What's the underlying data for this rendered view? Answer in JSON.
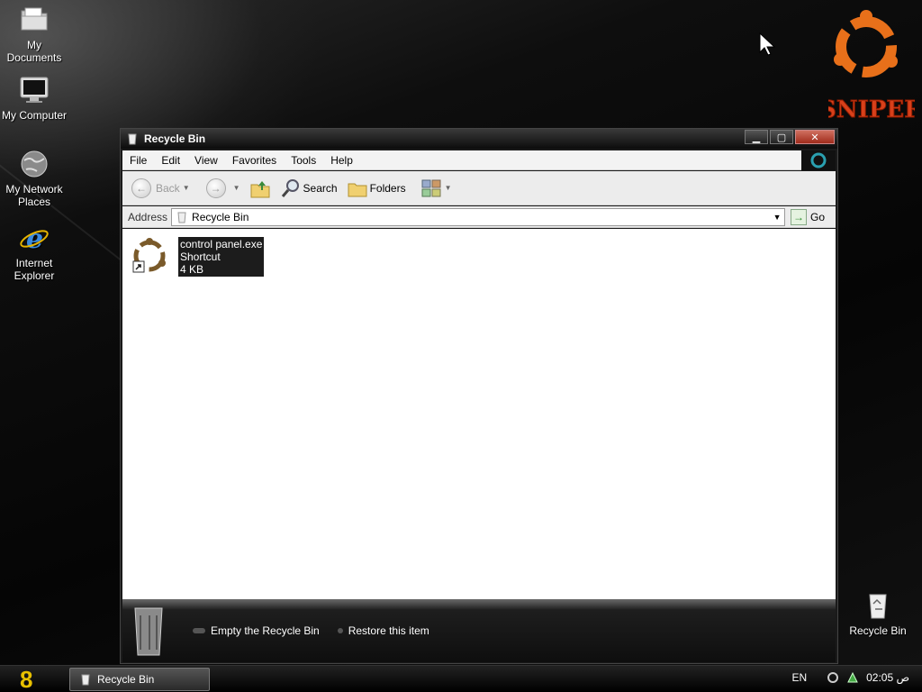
{
  "desktop": {
    "icons": [
      {
        "label": "My\nDocuments"
      },
      {
        "label": "My Computer"
      },
      {
        "label": "My Network\nPlaces"
      },
      {
        "label": "Internet\nExplorer"
      },
      {
        "label": "Recycle Bin"
      }
    ],
    "logo_text": "SNIPER"
  },
  "window": {
    "title": "Recycle Bin",
    "menu": [
      "File",
      "Edit",
      "View",
      "Favorites",
      "Tools",
      "Help"
    ],
    "toolbar": {
      "back_label": "Back",
      "search_label": "Search",
      "folders_label": "Folders"
    },
    "address": {
      "label": "Address",
      "value": "Recycle Bin",
      "go_label": "Go"
    },
    "file": {
      "name": "control panel.exe",
      "type": "Shortcut",
      "size": "4 KB"
    },
    "tasks": [
      "Empty the Recycle Bin",
      "Restore this item"
    ]
  },
  "taskbar": {
    "start_glyph": "8",
    "button_label": "Recycle Bin",
    "lang": "EN",
    "clock": "02:05 ص"
  },
  "colors": {
    "desktop_bg": "#050505",
    "window_chrome": "#1a1a1a",
    "selection": "#1c1c1c",
    "logo_orange": "#e8701a",
    "logo_text": "#d8401a"
  }
}
